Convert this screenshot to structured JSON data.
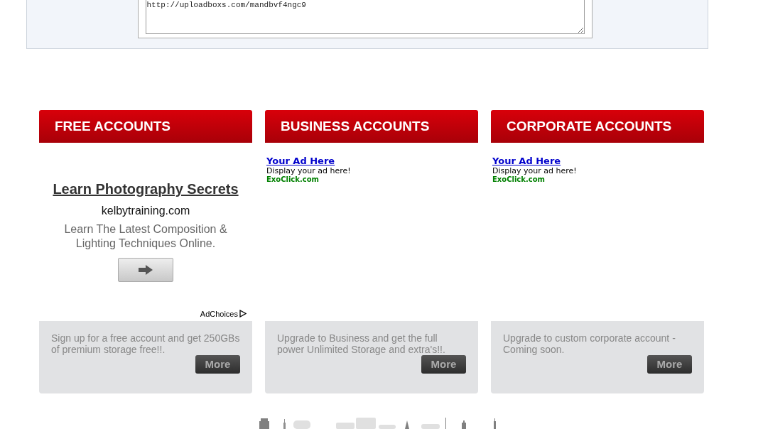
{
  "link_box": {
    "value": "http://uploadboxs.com/mandbvf4ngc9"
  },
  "plans": [
    {
      "title": "FREE ACCOUNTS",
      "ad": {
        "kind": "banner",
        "headline": "Learn Photography Secrets",
        "domain": "kelbytraining.com",
        "body": "Learn The Latest Composition & Lighting Techniques Online.",
        "adchoices": "AdChoices"
      },
      "description": "Sign up for a free account and get 250GBs of premium storage free!!.",
      "button": "More"
    },
    {
      "title": "BUSINESS ACCOUNTS",
      "ad": {
        "kind": "text",
        "headline": "Your Ad Here",
        "body": "Display your ad here!",
        "domain": "ExoClick.com"
      },
      "description": "Upgrade to Business and get the full power Unlimited Storage and extra's!!.",
      "button": "More"
    },
    {
      "title": "CORPORATE ACCOUNTS",
      "ad": {
        "kind": "text",
        "headline": "Your Ad Here",
        "body": "Display your ad here!",
        "domain": "ExoClick.com"
      },
      "description": "Upgrade to custom corporate account - Coming soon.",
      "button": "More"
    }
  ]
}
